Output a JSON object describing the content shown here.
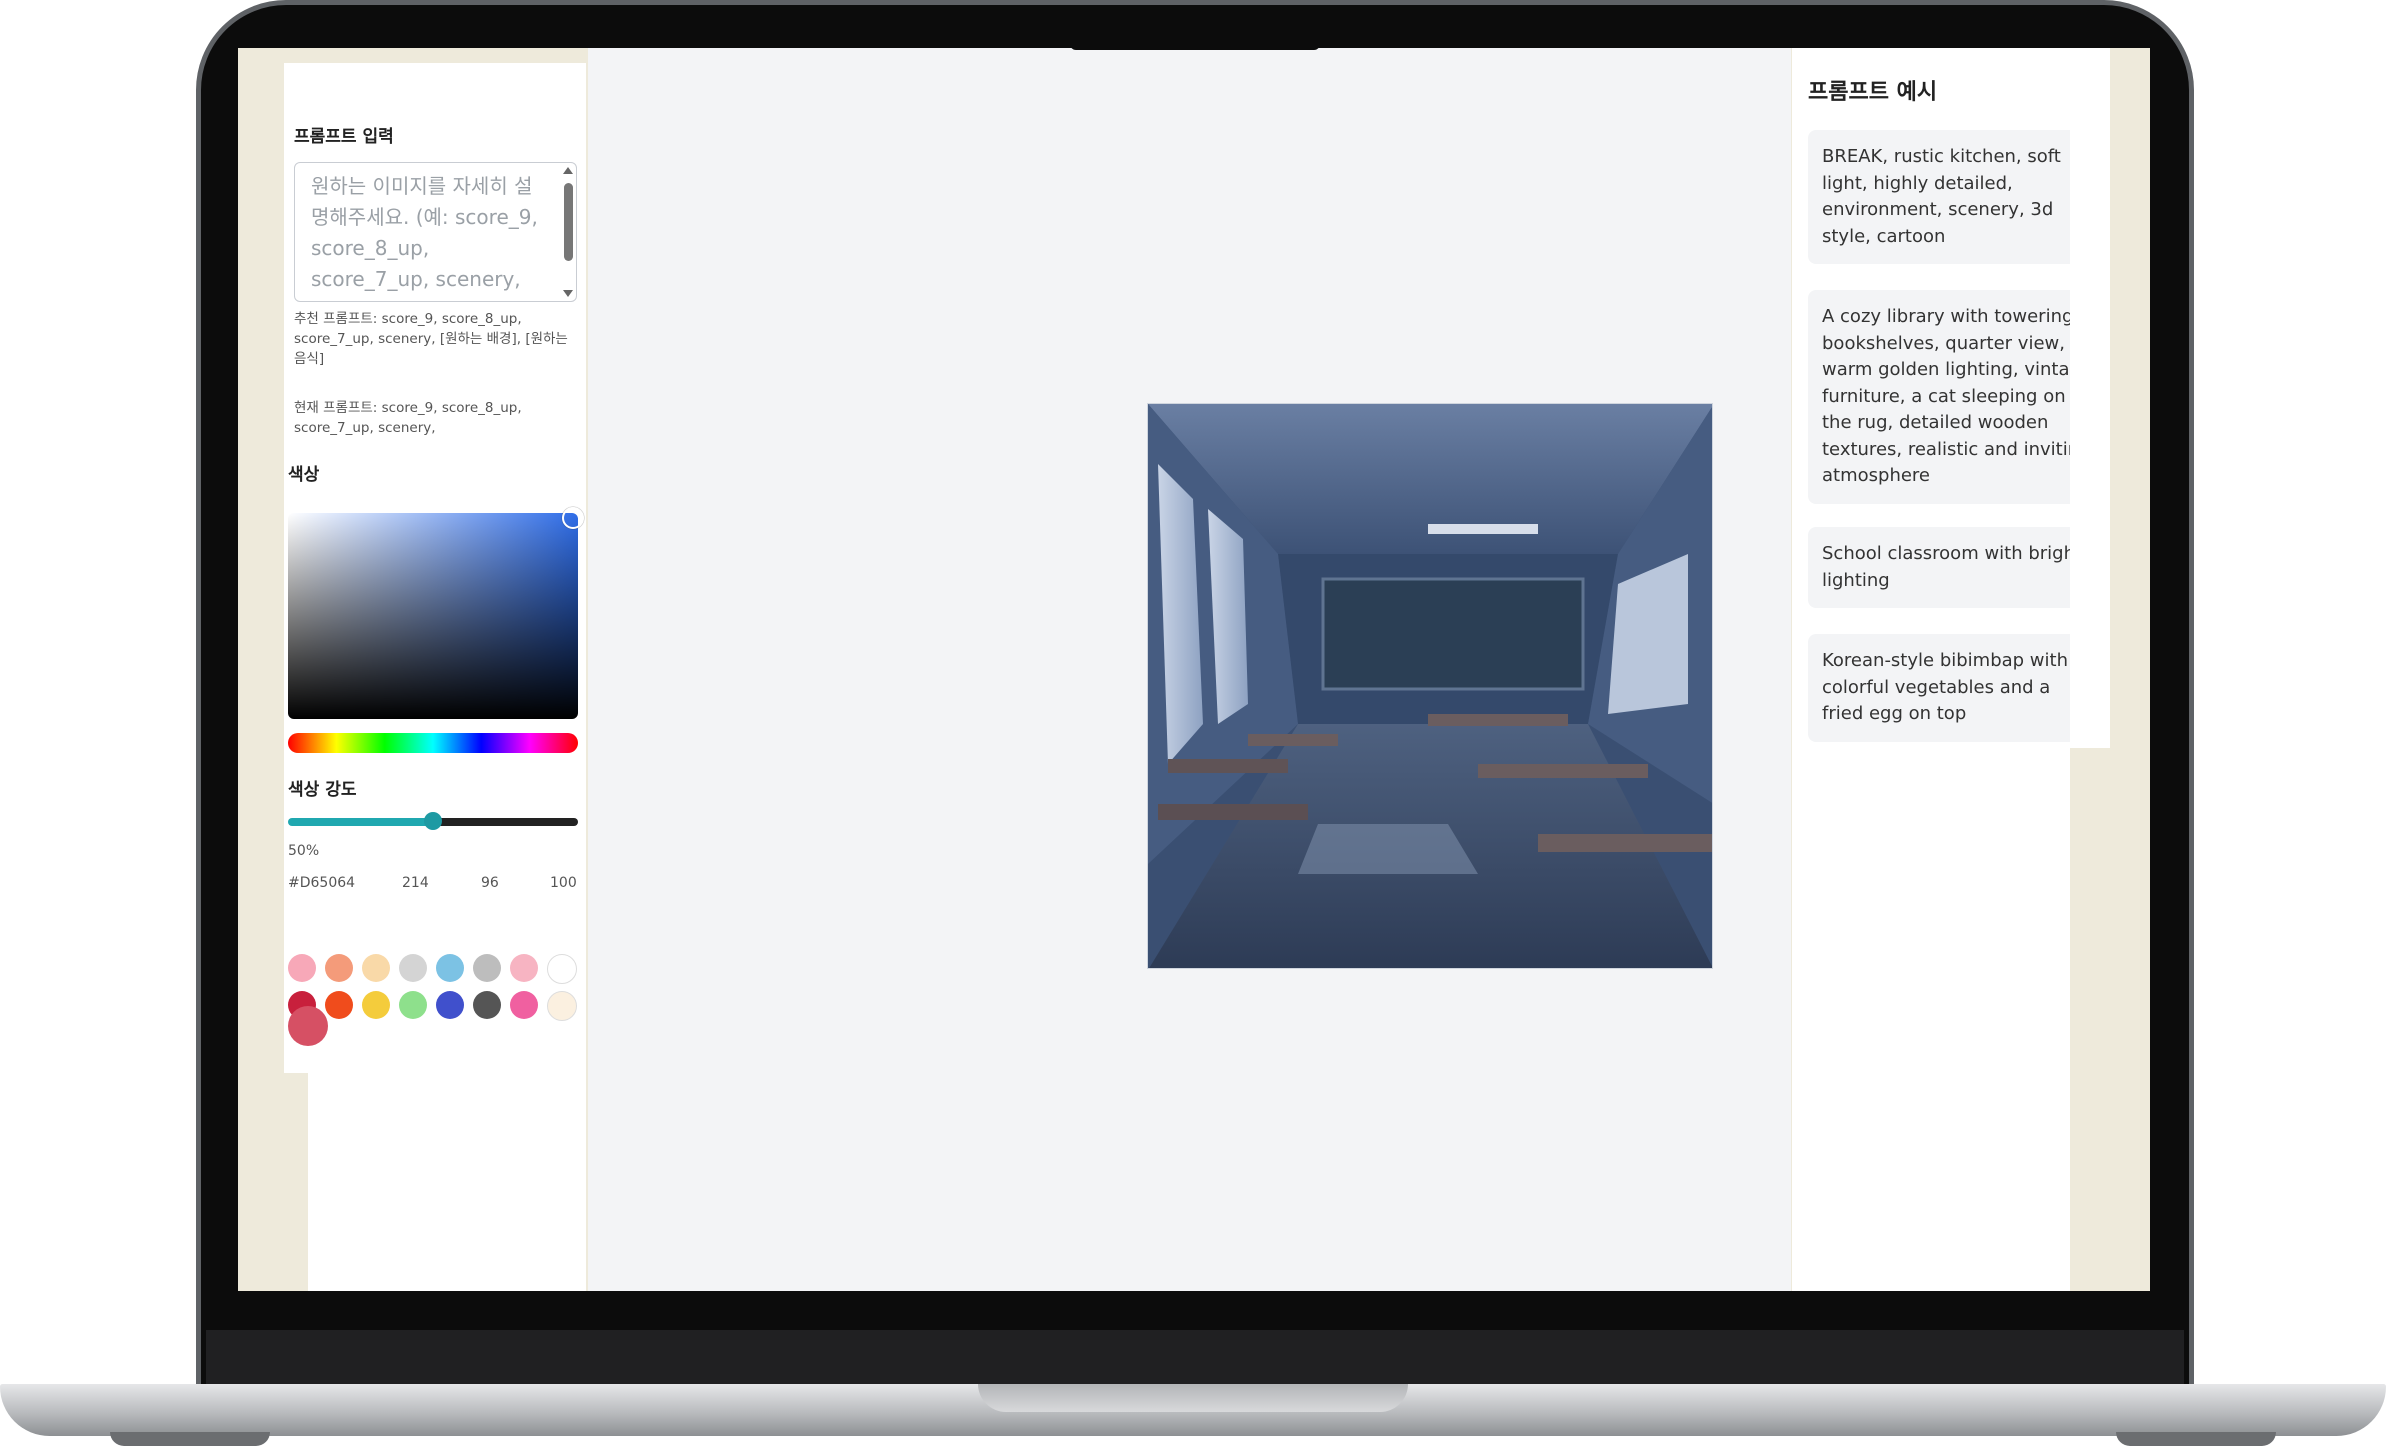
{
  "prompt_input": {
    "label": "프롬프트 입력",
    "placeholder": "원하는 이미지를 자세히 설명해주세요. (예: score_9, score_8_up, score_7_up, scenery, train station, natural",
    "recommended": "추천 프롬프트: score_9, score_8_up, score_7_up, scenery, [원하는 배경], [원하는 음식]",
    "current": "현재 프롬프트: score_9, score_8_up, score_7_up, scenery,"
  },
  "color": {
    "label": "색상",
    "intensity_label": "색상 강도",
    "intensity_value": 50,
    "intensity_text": "50%",
    "hex_text": "#D65064",
    "r": "214",
    "g": "96",
    "b": "100",
    "current_color": "#D65064",
    "picker_hue_color": "#2f6de8",
    "swatches_row1": [
      "#f7a8b8",
      "#f49b7a",
      "#f9d9a8",
      "#d4d4d4",
      "#7cc2e4",
      "#bdbdbd",
      "#f7b4c2",
      "#ffffff"
    ],
    "swatches_row2": [
      "#c8203c",
      "#f04c1c",
      "#f4cc3c",
      "#8ee08c",
      "#4050cc",
      "#555555",
      "#f060a0",
      "#fbf0e0"
    ]
  },
  "examples": {
    "title": "프롬프트 예시",
    "items": [
      "BREAK, rustic kitchen, soft light, highly detailed, environment, scenery, 3d style, cartoon",
      "A cozy library with towering bookshelves, quarter view, warm golden lighting, vintage furniture, a cat sleeping on the rug, detailed wooden textures, realistic and inviting atmosphere",
      "School classroom with bright lighting",
      "Korean-style bibimbap with colorful vegetables and a fried egg on top"
    ]
  }
}
